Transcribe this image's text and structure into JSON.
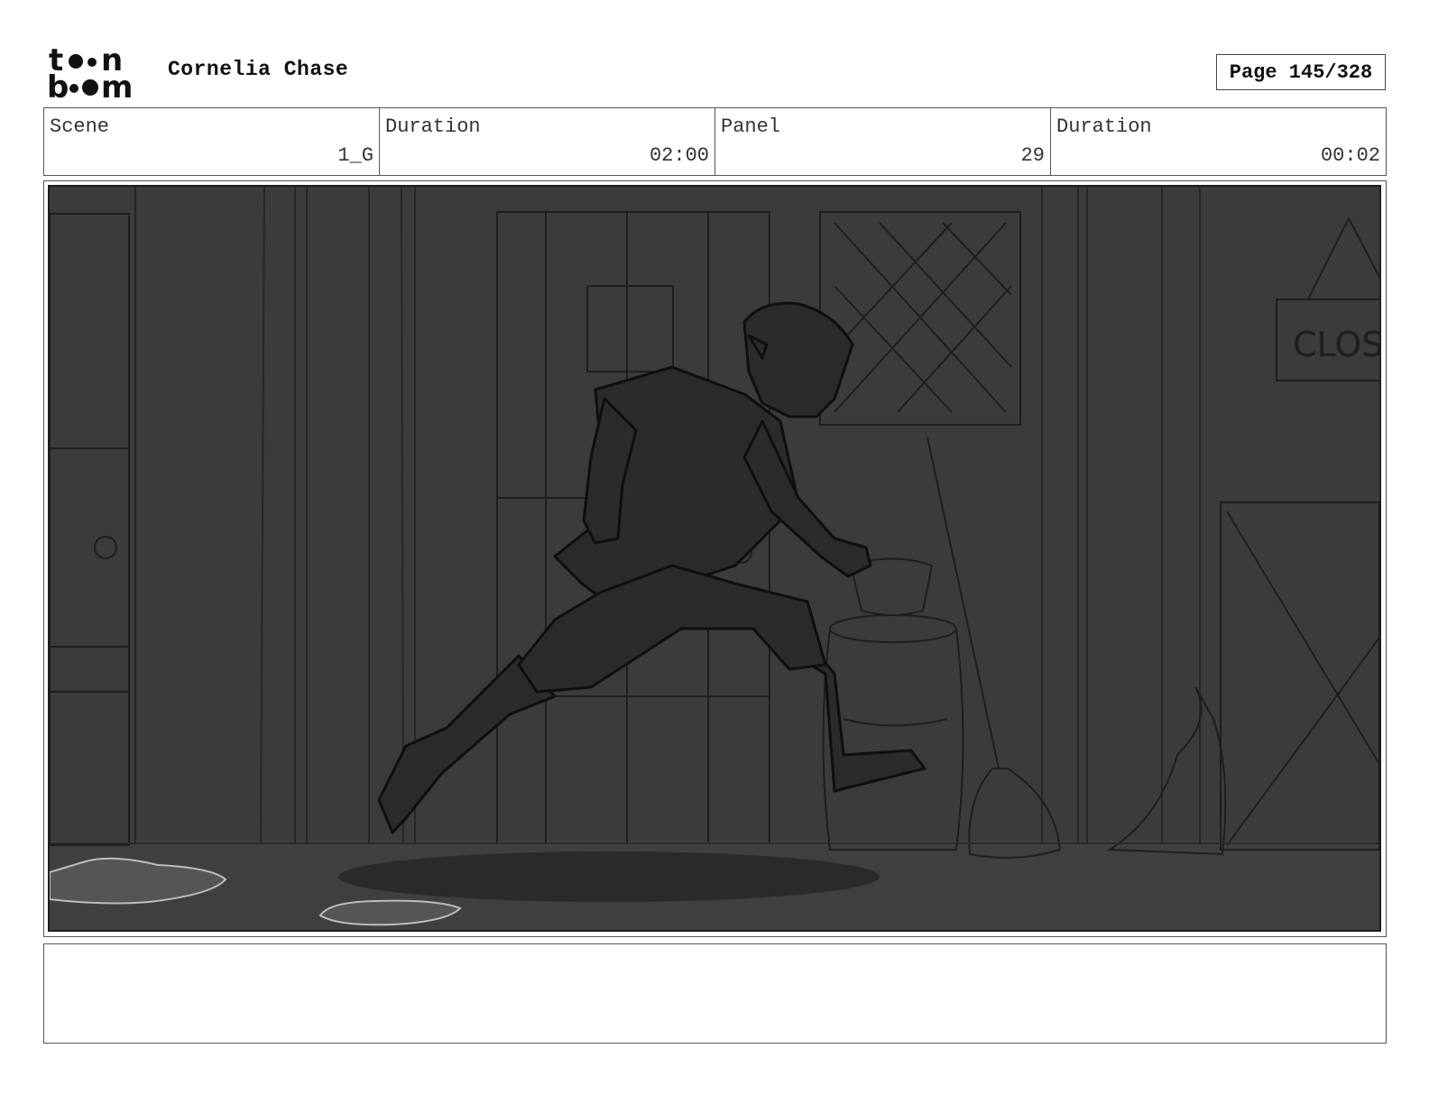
{
  "header": {
    "logo_icon": "toonboom-logo",
    "logo_lines": [
      "t••n",
      "b••m"
    ],
    "project_title": "Cornelia Chase",
    "page_label": "Page 145/328"
  },
  "info": {
    "scene_label": "Scene",
    "scene_value": "1_G",
    "scene_duration_label": "Duration",
    "scene_duration_value": "02:00",
    "panel_label": "Panel",
    "panel_value": "29",
    "panel_duration_label": "Duration",
    "panel_duration_value": "00:02"
  },
  "panel": {
    "sign_text": "CLOS",
    "background_color": "#3b3b3b",
    "line_color": "#1a1a1a"
  },
  "notes": {
    "text": ""
  }
}
